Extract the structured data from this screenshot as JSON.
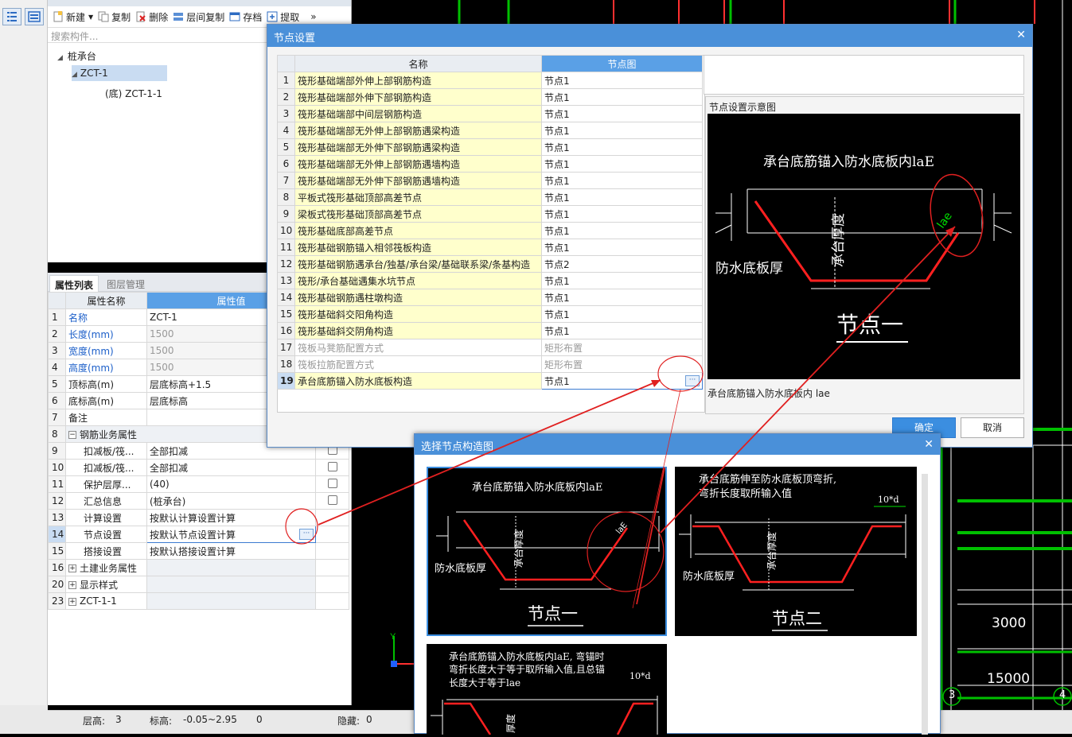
{
  "toolbar": {
    "new": "新建",
    "copy": "复制",
    "delete": "删除",
    "floor_copy": "层间复制",
    "archive": "存档",
    "extract": "提取",
    "more": "»"
  },
  "construct_tree": {
    "search_placeholder": "搜索构件...",
    "root": "桩承台",
    "child": "ZCT-1",
    "grandchild": "(底) ZCT-1-1"
  },
  "props_panel": {
    "tab_active": "属性列表",
    "tab_inactive": "图层管理",
    "col_name": "属性名称",
    "col_value": "属性值",
    "rows": [
      {
        "num": "1",
        "name": "名称",
        "value": "ZCT-1"
      },
      {
        "num": "2",
        "name": "长度(mm)",
        "value": "1500"
      },
      {
        "num": "3",
        "name": "宽度(mm)",
        "value": "1500"
      },
      {
        "num": "4",
        "name": "高度(mm)",
        "value": "1500"
      },
      {
        "num": "5",
        "name": "顶标高(m)",
        "value": "层底标高+1.5"
      },
      {
        "num": "6",
        "name": "底标高(m)",
        "value": "层底标高"
      },
      {
        "num": "7",
        "name": "备注",
        "value": ""
      },
      {
        "num": "8",
        "name": "钢筋业务属性",
        "value": ""
      },
      {
        "num": "9",
        "name": "扣减板/筏...",
        "value": "全部扣减"
      },
      {
        "num": "10",
        "name": "扣减板/筏...",
        "value": "全部扣减"
      },
      {
        "num": "11",
        "name": "保护层厚...",
        "value": "(40)"
      },
      {
        "num": "12",
        "name": "汇总信息",
        "value": "(桩承台)"
      },
      {
        "num": "13",
        "name": "计算设置",
        "value": "按默认计算设置计算"
      },
      {
        "num": "14",
        "name": "节点设置",
        "value": "按默认节点设置计算"
      },
      {
        "num": "15",
        "name": "搭接设置",
        "value": "按默认搭接设置计算"
      },
      {
        "num": "16",
        "name": "土建业务属性",
        "value": ""
      },
      {
        "num": "20",
        "name": "显示样式",
        "value": ""
      },
      {
        "num": "23",
        "name": "ZCT-1-1",
        "value": ""
      }
    ]
  },
  "status_bar": {
    "floor_height_label": "层高:",
    "floor_height_value": "3",
    "elevation_label": "标高:",
    "elevation_value": "-0.05~2.95",
    "zero": "0",
    "hidden_label": "隐藏:",
    "hidden_value": "0"
  },
  "canvas": {
    "dim_3000": "3000",
    "dim_15000": "15000",
    "axis_3": "3",
    "axis_4": "4"
  },
  "node_dialog": {
    "title": "节点设置",
    "col_name": "名称",
    "col_node": "节点图",
    "rows": [
      {
        "num": "1",
        "name": "筏形基础端部外伸上部钢筋构造",
        "node": "节点1"
      },
      {
        "num": "2",
        "name": "筏形基础端部外伸下部钢筋构造",
        "node": "节点1"
      },
      {
        "num": "3",
        "name": "筏形基础端部中间层钢筋构造",
        "node": "节点1"
      },
      {
        "num": "4",
        "name": "筏形基础端部无外伸上部钢筋遇梁构造",
        "node": "节点1"
      },
      {
        "num": "5",
        "name": "筏形基础端部无外伸下部钢筋遇梁构造",
        "node": "节点1"
      },
      {
        "num": "6",
        "name": "筏形基础端部无外伸上部钢筋遇墙构造",
        "node": "节点1"
      },
      {
        "num": "7",
        "name": "筏形基础端部无外伸下部钢筋遇墙构造",
        "node": "节点1"
      },
      {
        "num": "8",
        "name": "平板式筏形基础顶部高差节点",
        "node": "节点1"
      },
      {
        "num": "9",
        "name": "梁板式筏形基础顶部高差节点",
        "node": "节点1"
      },
      {
        "num": "10",
        "name": "筏形基础底部高差节点",
        "node": "节点1"
      },
      {
        "num": "11",
        "name": "筏形基础钢筋锚入相邻筏板构造",
        "node": "节点1"
      },
      {
        "num": "12",
        "name": "筏形基础钢筋遇承台/独基/承台梁/基础联系梁/条基构造",
        "node": "节点2"
      },
      {
        "num": "13",
        "name": "筏形/承台基础遇集水坑节点",
        "node": "节点1"
      },
      {
        "num": "14",
        "name": "筏形基础钢筋遇柱墩构造",
        "node": "节点1"
      },
      {
        "num": "15",
        "name": "筏形基础斜交阳角构造",
        "node": "节点1"
      },
      {
        "num": "16",
        "name": "筏形基础斜交阴角构造",
        "node": "节点1"
      },
      {
        "num": "17",
        "name": "筏板马凳筋配置方式",
        "node": "矩形布置"
      },
      {
        "num": "18",
        "name": "筏板拉筋配置方式",
        "node": "矩形布置"
      },
      {
        "num": "19",
        "name": "承台底筋锚入防水底板构造",
        "node": "节点1"
      }
    ],
    "preview_title": "节点设置示意图",
    "preview_caption": "承台底筋锚入防水底板内 lae",
    "diagram_top_text": "承台底筋锚入防水底板内laE",
    "diagram_lae": "lae",
    "diagram_vertical": "承台厚度",
    "diagram_left": "防水底板厚",
    "diagram_node": "节点一",
    "ok": "确定",
    "cancel": "取消"
  },
  "select_dialog": {
    "title": "选择节点构造图",
    "thumb1": {
      "top": "承台底筋锚入防水底板内laE",
      "lae": "laE",
      "vertical": "承台厚度",
      "left": "防水底板厚",
      "node": "节点一"
    },
    "thumb2": {
      "top1": "承台底筋伸至防水底板顶弯折,",
      "top2": "弯折长度取所输入值",
      "dim": "10*d",
      "vertical": "承台厚度",
      "left": "防水底板厚",
      "node": "节点二"
    },
    "thumb3": {
      "top1": "承台底筋锚入防水底板内laE, 弯锚时",
      "top2": "弯折长度大于等于取所输入值,且总锚",
      "top3": "长度大于等于lae",
      "dim": "10*d",
      "vertical": "厚度"
    }
  },
  "colors": {
    "accent": "#4a90d9",
    "highlight_yellow": "#ffffcc",
    "annotation_red": "#e02020",
    "canvas_green": "#00c000"
  }
}
